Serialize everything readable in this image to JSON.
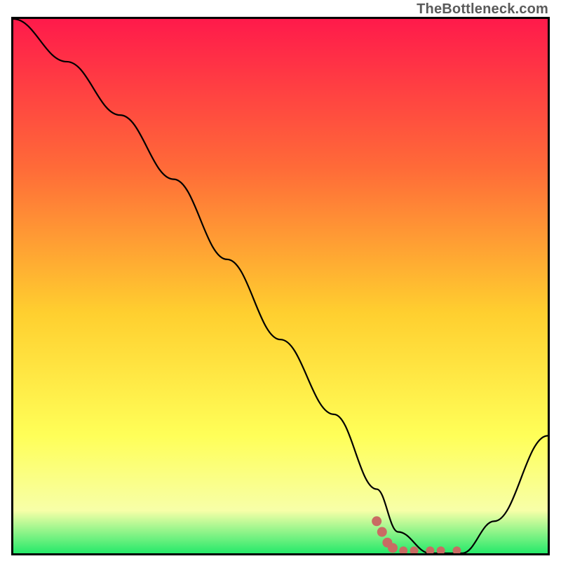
{
  "attribution": "TheBottleneck.com",
  "colors": {
    "gradient_top": "#ff1a4b",
    "gradient_mid1": "#ff6b38",
    "gradient_mid2": "#ffcf2f",
    "gradient_mid3": "#ffff58",
    "gradient_bottom_light": "#f7ffa8",
    "gradient_green": "#26e96a",
    "curve": "#000000",
    "dots": "#c96b63"
  },
  "chart_data": {
    "type": "line",
    "title": "",
    "xlabel": "",
    "ylabel": "",
    "xlim": [
      0,
      100
    ],
    "ylim": [
      0,
      100
    ],
    "series": [
      {
        "name": "bottleneck-curve",
        "x": [
          0,
          10,
          20,
          30,
          40,
          50,
          60,
          68,
          72,
          78,
          84,
          90,
          100
        ],
        "y": [
          100,
          92,
          82,
          70,
          55,
          40,
          26,
          12,
          4,
          0,
          0,
          6,
          22
        ]
      }
    ],
    "markers": {
      "name": "optimal-zone-dots",
      "points": [
        {
          "x": 68,
          "y": 6
        },
        {
          "x": 69,
          "y": 4
        },
        {
          "x": 70,
          "y": 2
        },
        {
          "x": 71,
          "y": 1
        },
        {
          "x": 73,
          "y": 0.5
        },
        {
          "x": 75,
          "y": 0.5
        },
        {
          "x": 78,
          "y": 0.5
        },
        {
          "x": 80,
          "y": 0.5
        },
        {
          "x": 83,
          "y": 0.5
        }
      ]
    }
  }
}
